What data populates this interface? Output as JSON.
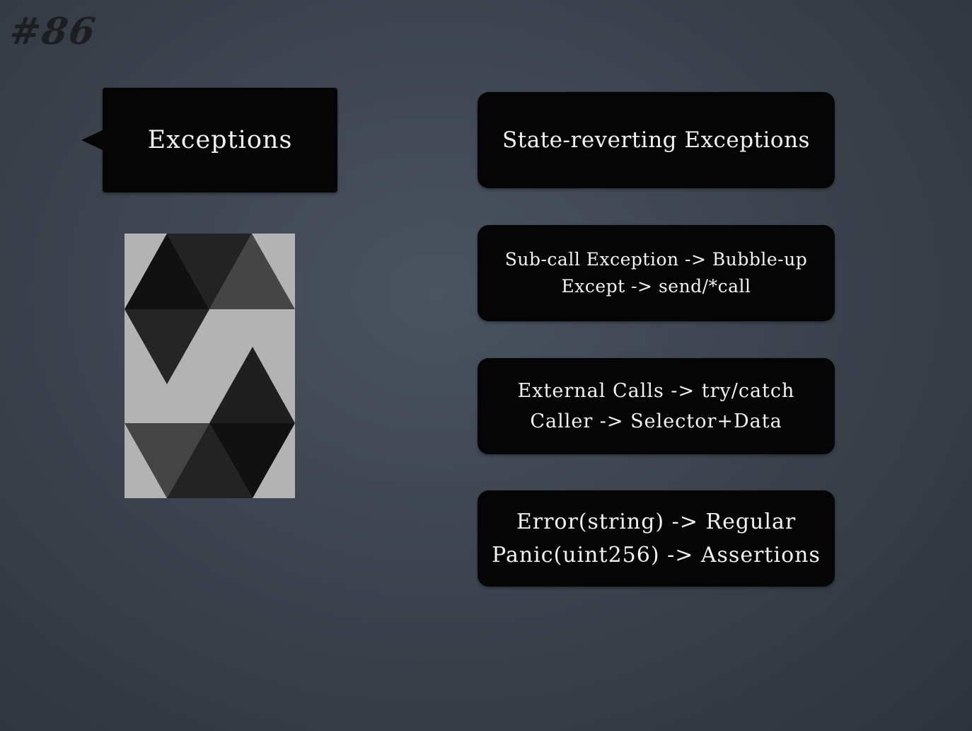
{
  "slide": {
    "number": "#86",
    "callout_title": "Exceptions",
    "logo_name": "solidity-logo",
    "cards": [
      {
        "lines": [
          "State-reverting Exceptions"
        ]
      },
      {
        "lines": [
          "Sub-call Exception -> Bubble-up",
          "Except -> send/*call"
        ]
      },
      {
        "lines": [
          "External Calls -> try/catch",
          "Caller -> Selector+Data"
        ]
      },
      {
        "lines": [
          "Error(string) -> Regular",
          "Panic(uint256) -> Assertions"
        ]
      }
    ]
  },
  "colors": {
    "background": "#3d444f",
    "box": "#050505",
    "text": "#f3f3f3",
    "logo_bg": "#b3b3b3"
  }
}
